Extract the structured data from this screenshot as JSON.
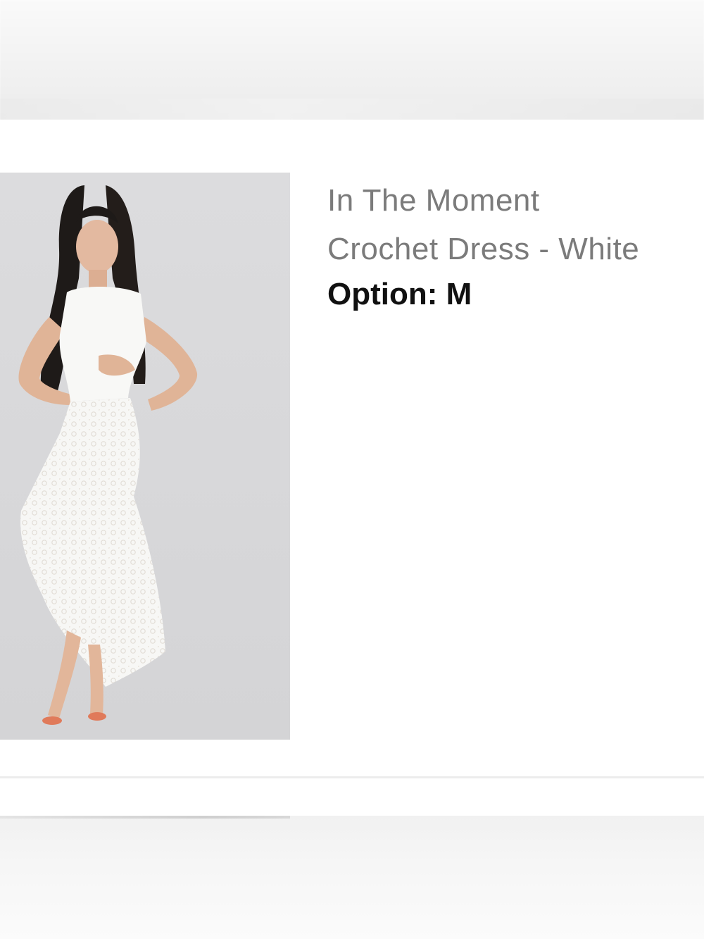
{
  "product": {
    "name_line1": "In The Moment",
    "name_line2": "Crochet Dress - White",
    "option": "Option: M"
  },
  "colors": {
    "name_text": "#7b7b7b",
    "option_text": "#111111",
    "image_background": "#d9d9db"
  }
}
